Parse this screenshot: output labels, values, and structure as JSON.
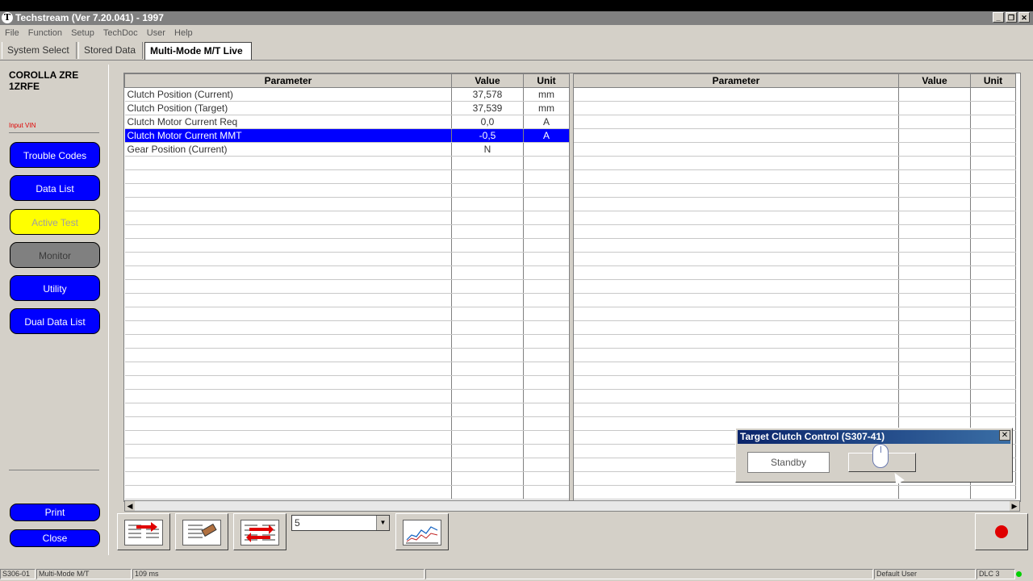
{
  "window": {
    "title": "Techstream (Ver 7.20.041) - 1997",
    "buttons": [
      "_",
      "❐",
      "✕"
    ]
  },
  "menu": [
    "File",
    "Function",
    "Setup",
    "TechDoc",
    "User",
    "Help"
  ],
  "tabs": [
    {
      "label": "System Select",
      "active": false
    },
    {
      "label": "Stored Data",
      "active": false
    },
    {
      "label": "Multi-Mode M/T Live",
      "active": true
    }
  ],
  "sidebar": {
    "vehicle_line1": "COROLLA ZRE",
    "vehicle_line2": "1ZRFE",
    "input_vin": "Input VIN",
    "buttons": {
      "trouble_codes": "Trouble Codes",
      "data_list": "Data List",
      "active_test": "Active Test",
      "monitor": "Monitor",
      "utility": "Utility",
      "dual_data_list": "Dual Data List",
      "print": "Print",
      "close": "Close"
    }
  },
  "left_table": {
    "headers": {
      "parameter": "Parameter",
      "value": "Value",
      "unit": "Unit"
    },
    "rows": [
      {
        "parameter": "Clutch Position (Current)",
        "value": "37,578",
        "unit": "mm"
      },
      {
        "parameter": "Clutch Position (Target)",
        "value": "37,539",
        "unit": "mm"
      },
      {
        "parameter": "Clutch Motor Current Req",
        "value": "0,0",
        "unit": "A"
      },
      {
        "parameter": "Clutch Motor Current MMT",
        "value": "-0,5",
        "unit": "A"
      },
      {
        "parameter": "Gear Position (Current)",
        "value": "N",
        "unit": ""
      }
    ],
    "selected_row": 3,
    "empty_rows": 25
  },
  "right_table": {
    "headers": {
      "parameter": "Parameter",
      "value": "Value",
      "unit": "Unit"
    },
    "empty_rows": 30
  },
  "toolbar": {
    "interval_value": "5",
    "dropdown_arrow": "▼"
  },
  "dialog": {
    "title": "Target Clutch Control (S307-41)",
    "close": "✕",
    "status": "Standby"
  },
  "scroll": {
    "left": "◀",
    "right": "▶"
  },
  "statusbar": {
    "code": "S306-01",
    "mode": "Multi-Mode M/T",
    "timing": "109 ms",
    "user": "Default User",
    "connection": "DLC 3"
  },
  "colors": {
    "selection": "#0000ff",
    "sidebar_button": "#0000ff",
    "active_test": "#ffff00",
    "monitor": "#808080",
    "record": "#e00000",
    "link_led": "#00d000"
  }
}
